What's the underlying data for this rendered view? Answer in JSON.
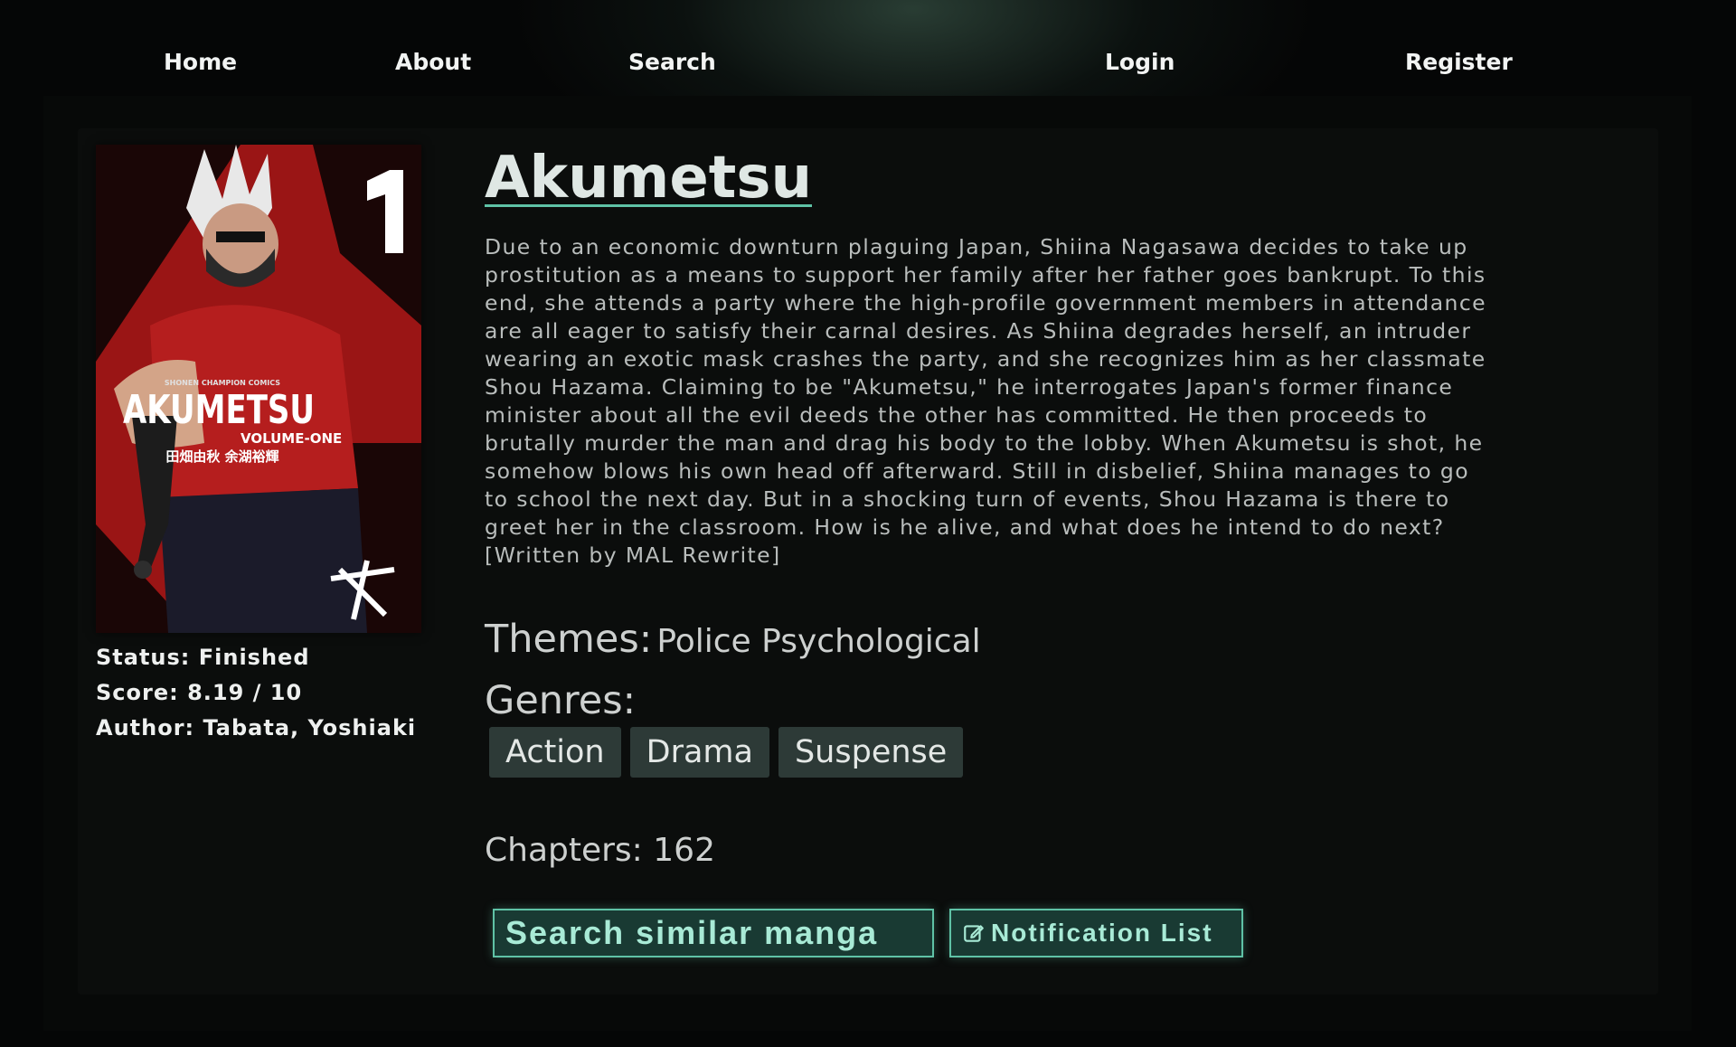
{
  "nav": {
    "home": "Home",
    "about": "About",
    "search": "Search",
    "login": "Login",
    "register": "Register"
  },
  "manga": {
    "title": "Akumetsu",
    "synopsis": "Due to an economic downturn plaguing Japan, Shiina Nagasawa decides to take up prostitution as a means to support her family after her father goes bankrupt. To this end, she attends a party where the high-profile government members in attendance are all eager to satisfy their carnal desires. As Shiina degrades herself, an intruder wearing an exotic mask crashes the party, and she recognizes him as her classmate Shou Hazama. Claiming to be \"Akumetsu,\" he interrogates Japan's former finance minister about all the evil deeds the other has committed. He then proceeds to brutally murder the man and drag his body to the lobby. When Akumetsu is shot, he somehow blows his own head off afterward. Still in disbelief, Shiina manages to go to school the next day. But in a shocking turn of events, Shou Hazama is there to greet her in the classroom. How is he alive, and what does he intend to do next? [Written by MAL Rewrite]",
    "status": "Status: Finished",
    "score": "Score: 8.19 / 10",
    "author": "Author: Tabata, Yoshiaki",
    "themes_label": "Themes:",
    "themes_value": "Police Psychological",
    "genres_label": "Genres:",
    "genres": [
      "Action",
      "Drama",
      "Suspense"
    ],
    "chapters": "Chapters: 162"
  },
  "cover": {
    "imprint": "SHONEN CHAMPION COMICS",
    "volume_number": "1",
    "logo_text": "AKUMETSU",
    "volume_text": "VOLUME-ONE",
    "credits": "田畑由秋 余湖裕輝"
  },
  "actions": {
    "search_similar": "Search similar manga",
    "notification_list": "Notification List",
    "notification_icon": "edit-icon"
  },
  "colors": {
    "accent": "#5fc2a6",
    "chip_bg": "#2d3a37",
    "page_bg": "#050606"
  }
}
